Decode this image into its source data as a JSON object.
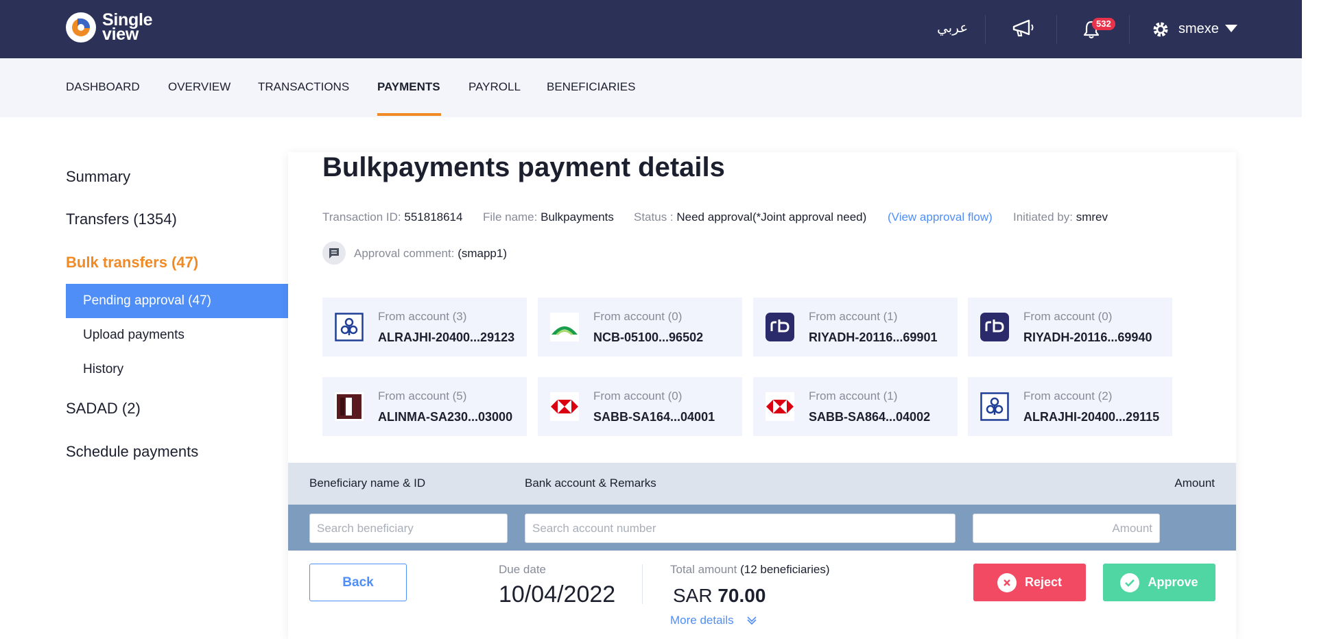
{
  "brand": {
    "line1": "Single",
    "line2": "view"
  },
  "topbar": {
    "language": "عربي",
    "notifications_count": "532",
    "username": "smexe"
  },
  "nav": {
    "items": [
      "DASHBOARD",
      "OVERVIEW",
      "TRANSACTIONS",
      "PAYMENTS",
      "PAYROLL",
      "BENEFICIARIES"
    ],
    "active": "PAYMENTS"
  },
  "sidebar": {
    "summary": "Summary",
    "transfers": "Transfers (1354)",
    "bulk": "Bulk transfers (47)",
    "pending": "Pending approval (47)",
    "upload": "Upload payments",
    "history": "History",
    "sadad": "SADAD (2)",
    "schedule": "Schedule payments"
  },
  "details": {
    "title": "Bulkpayments payment details",
    "transaction_id_label": "Transaction ID:",
    "transaction_id": "551818614",
    "file_name_label": "File name:",
    "file_name": "Bulkpayments",
    "status_label": "Status :",
    "status": "Need approval(*Joint approval need)",
    "view_flow": "(View approval flow)",
    "initiated_label": "Initiated by:",
    "initiated_by": "smrev",
    "comment_label": "Approval comment:",
    "comment": "(smapp1)"
  },
  "accounts": [
    {
      "label": "From account (3)",
      "number": "ALRAJHI-20400...29123",
      "bank": "alrajhi"
    },
    {
      "label": "From account (0)",
      "number": "NCB-05100...96502",
      "bank": "ncb"
    },
    {
      "label": "From account (1)",
      "number": "RIYADH-20116...69901",
      "bank": "riyad"
    },
    {
      "label": "From account (0)",
      "number": "RIYADH-20116...69940",
      "bank": "riyad"
    },
    {
      "label": "From account (5)",
      "number": "ALINMA-SA230...03000",
      "bank": "alinma"
    },
    {
      "label": "From account (0)",
      "number": "SABB-SA164...04001",
      "bank": "sabb"
    },
    {
      "label": "From account (1)",
      "number": "SABB-SA864...04002",
      "bank": "sabb"
    },
    {
      "label": "From account (2)",
      "number": "ALRAJHI-20400...29115",
      "bank": "alrajhi"
    }
  ],
  "table": {
    "col_beneficiary": "Beneficiary name & ID",
    "col_bank": "Bank account & Remarks",
    "col_amount": "Amount",
    "ph_beneficiary": "Search beneficiary",
    "ph_account": "Search account number",
    "ph_amount": "Amount"
  },
  "footer": {
    "back": "Back",
    "due_label": "Due date",
    "due_date": "10/04/2022",
    "total_label": "Total amount",
    "beneficiaries": "(12 beneficiaries)",
    "currency": "SAR",
    "total": "70.00",
    "more_details": "More details",
    "reject": "Reject",
    "approve": "Approve"
  },
  "colors": {
    "topbar": "#2b3157",
    "accent": "#f08a24",
    "primary": "#4f8ef7",
    "reject": "#f24a62",
    "approve": "#4fd6a3"
  }
}
